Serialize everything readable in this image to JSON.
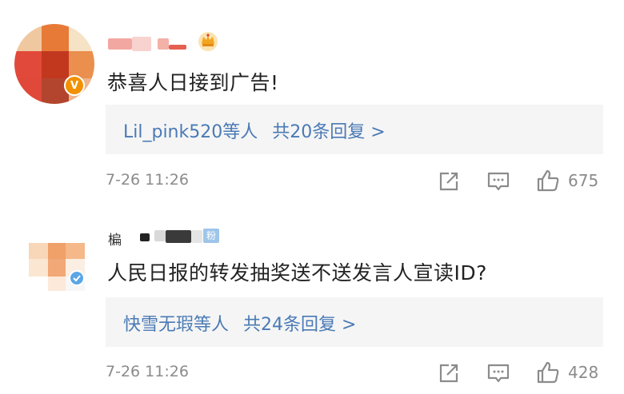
{
  "comments": [
    {
      "text": "恭喜人日接到广告!",
      "reply_users": "Lil_pink520等人",
      "reply_count": "共20条回复 >",
      "time": "7-26 11:26",
      "likes": "675"
    },
    {
      "username_partial": "楄",
      "fan_badge": "粉",
      "text": "人民日报的转发抽奖送不送发言人宣读ID?",
      "reply_users": "快雪无瑕等人",
      "reply_count": "共24条回复 >",
      "time": "7-26 11:26",
      "likes": "428"
    }
  ],
  "icons": {
    "share": "share-icon",
    "comment": "comment-icon",
    "like": "thumbs-up-icon",
    "crown": "crown-icon",
    "verified": "verified-badge-icon"
  },
  "colors": {
    "link": "#4a7ab5",
    "meta": "#8b8b8b",
    "text": "#222222",
    "reply_bg": "#f5f5f5",
    "verified": "#f29100"
  }
}
